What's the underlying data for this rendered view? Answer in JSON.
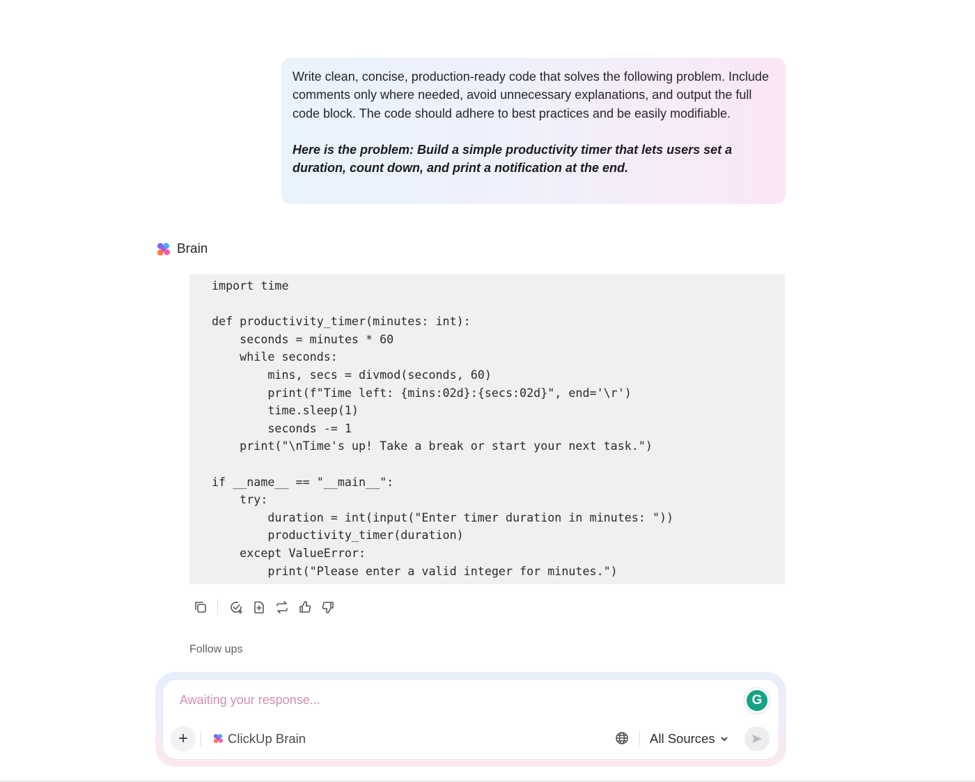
{
  "prompt": {
    "paragraph": "Write clean, concise, production-ready code that solves the following problem. Include comments only where needed, avoid unnecessary explanations, and output the full code block. The code should adhere to best practices and be easily modifiable.",
    "problem": "Here is the problem: Build a simple productivity timer that lets users set a duration, count down, and print a notification at the end."
  },
  "assistant": {
    "name": "Brain",
    "logo_icon": "clickup-brain-logo-icon"
  },
  "code": "import time\n\ndef productivity_timer(minutes: int):\n    seconds = minutes * 60\n    while seconds:\n        mins, secs = divmod(seconds, 60)\n        print(f\"Time left: {mins:02d}:{secs:02d}\", end='\\r')\n        time.sleep(1)\n        seconds -= 1\n    print(\"\\nTime's up! Take a break or start your next task.\")\n\nif __name__ == \"__main__\":\n    try:\n        duration = int(input(\"Enter timer duration in minutes: \"))\n        productivity_timer(duration)\n    except ValueError:\n        print(\"Please enter a valid integer for minutes.\")",
  "actions": {
    "icons": [
      "copy-icon",
      "create-task-icon",
      "create-doc-icon",
      "regenerate-icon",
      "thumbs-up-icon",
      "thumbs-down-icon"
    ]
  },
  "followups": {
    "label": "Follow ups"
  },
  "composer": {
    "placeholder": "Awaiting your response...",
    "model_label": "ClickUp Brain",
    "sources_label": "All Sources",
    "grammarly_letter": "G"
  },
  "colors": {
    "placeholder": "#d08fae",
    "code_background": "#f0f0f0",
    "grammarly": "#15a383"
  }
}
